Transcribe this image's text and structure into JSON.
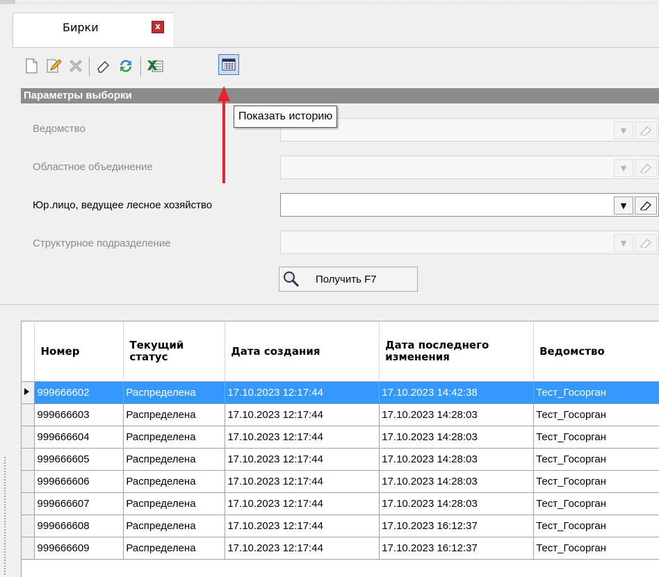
{
  "tab": {
    "title": "Бирки",
    "close_symbol": "x"
  },
  "toolbar": {
    "buttons": [
      "new-icon",
      "edit-icon",
      "delete-icon",
      "clear-icon",
      "refresh-icon",
      "export-excel-icon",
      "history-icon"
    ],
    "tooltip": "Показать историю"
  },
  "params": {
    "header": "Параметры выборки",
    "fields": [
      {
        "label": "Ведомство",
        "value": "",
        "enabled": false
      },
      {
        "label": "Областное объединение",
        "value": "",
        "enabled": false
      },
      {
        "label": "Юр.лицо, ведущее лесное хозяйство",
        "value": "",
        "enabled": true
      },
      {
        "label": "Структурное подразделение",
        "value": "",
        "enabled": false
      }
    ],
    "get_button": "Получить F7"
  },
  "grid": {
    "columns": [
      "Номер",
      "Текущий статус",
      "Дата создания",
      "Дата последнего изменения",
      "Ведомство"
    ],
    "rows": [
      [
        "999666602",
        "Распределена",
        "17.10.2023 12:17:44",
        "17.10.2023 14:42:38",
        "Тест_Госорган"
      ],
      [
        "999666603",
        "Распределена",
        "17.10.2023 12:17:44",
        "17.10.2023 14:28:03",
        "Тест_Госорган"
      ],
      [
        "999666604",
        "Распределена",
        "17.10.2023 12:17:44",
        "17.10.2023 14:28:03",
        "Тест_Госорган"
      ],
      [
        "999666605",
        "Распределена",
        "17.10.2023 12:17:44",
        "17.10.2023 14:28:03",
        "Тест_Госорган"
      ],
      [
        "999666606",
        "Распределена",
        "17.10.2023 12:17:44",
        "17.10.2023 14:28:03",
        "Тест_Госорган"
      ],
      [
        "999666607",
        "Распределена",
        "17.10.2023 12:17:44",
        "17.10.2023 14:28:03",
        "Тест_Госорган"
      ],
      [
        "999666608",
        "Распределена",
        "17.10.2023 12:17:44",
        "17.10.2023 16:12:37",
        "Тест_Госорган"
      ],
      [
        "999666609",
        "Распределена",
        "17.10.2023 12:17:44",
        "17.10.2023 16:12:37",
        "Тест_Госорган"
      ]
    ],
    "selected_row": 0
  },
  "colors": {
    "selection": "#3399ff",
    "header_band": "#8c8c8c",
    "annotation_arrow": "#e8222a"
  }
}
